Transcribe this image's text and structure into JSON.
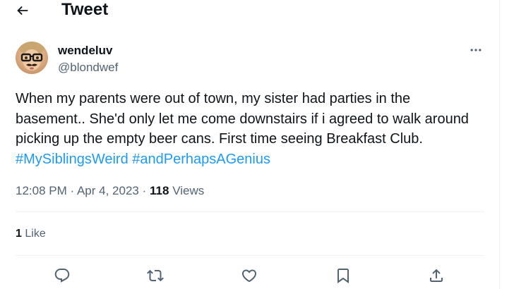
{
  "header": {
    "back_icon": "arrow-left-icon",
    "title": "Tweet"
  },
  "author": {
    "display_name": "wendeluv",
    "handle": "@blondwef",
    "avatar_icon": "avatar-with-glasses-mustache"
  },
  "more_icon": "ellipsis-icon",
  "tweet": {
    "lines": [
      "When my parents were out of town, my sister had parties in the",
      "basement.. She'd only let me come downstairs if i agreed to walk around",
      "picking up the empty beer cans. First time seeing Breakfast Club."
    ],
    "hashtags": [
      "#MySiblingsWeird",
      "#andPerhapsAGenius"
    ]
  },
  "meta": {
    "time": "12:08 PM",
    "separator": "·",
    "date": "Apr 4, 2023",
    "views_count": "118",
    "views_label": "Views"
  },
  "engagement": {
    "likes_count": "1",
    "likes_label": "Like"
  },
  "actions": [
    {
      "name": "reply",
      "icon": "reply-icon"
    },
    {
      "name": "retweet",
      "icon": "retweet-icon"
    },
    {
      "name": "like",
      "icon": "heart-icon"
    },
    {
      "name": "bookmark",
      "icon": "bookmark-icon"
    },
    {
      "name": "share",
      "icon": "share-icon"
    }
  ],
  "colors": {
    "text": "#0f1419",
    "secondary": "#536471",
    "accent": "#1d9bf0",
    "divider": "#eff3f4"
  }
}
